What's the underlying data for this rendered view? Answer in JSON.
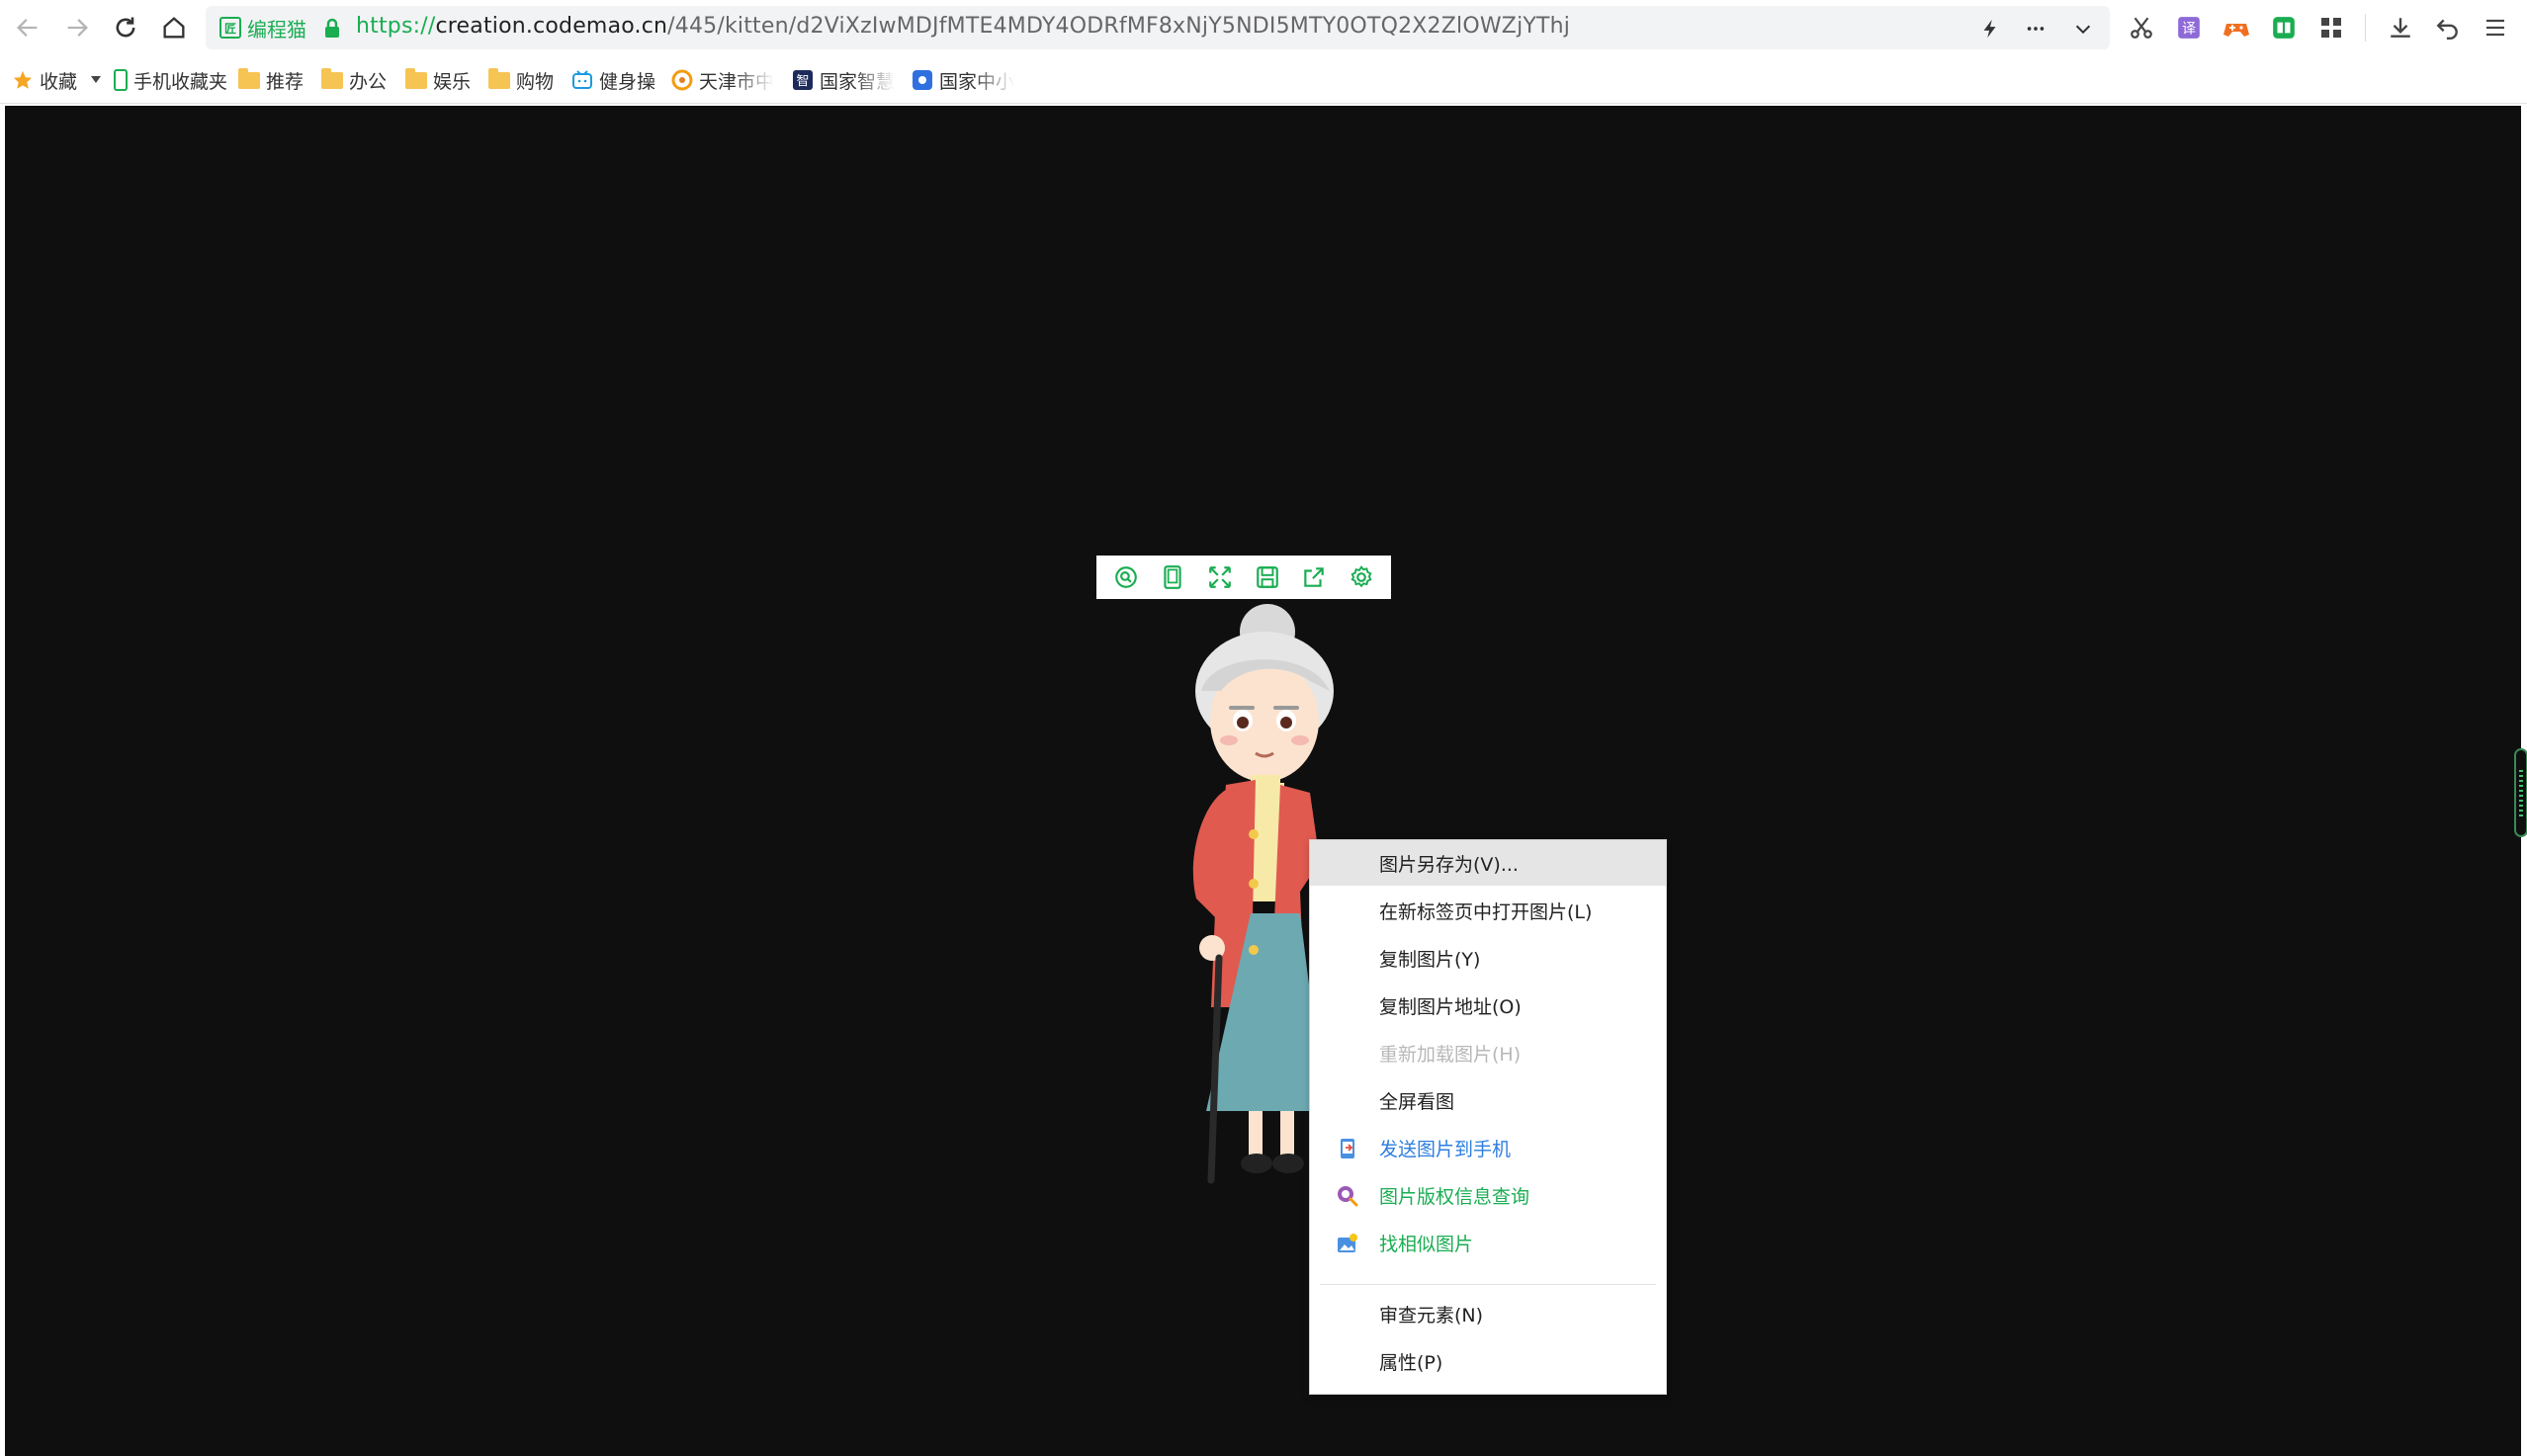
{
  "browser": {
    "site_name": "编程猫",
    "site_badge": "匠",
    "url_protocol": "https://",
    "url_host": "creation.codemao.cn",
    "url_path": "/445/kitten/d2ViXzIwMDJfMTE4MDY4ODRfMF8xNjY5NDI5MTY0OTQ2X2ZlOWZjYThj",
    "accent_color": "#1aad52"
  },
  "bookmarks": [
    {
      "label": "收藏",
      "icon": "star-icon"
    },
    {
      "label": "手机收藏夹",
      "icon": "phone-icon"
    },
    {
      "label": "推荐",
      "icon": "folder-icon"
    },
    {
      "label": "办公",
      "icon": "folder-icon"
    },
    {
      "label": "娱乐",
      "icon": "folder-icon"
    },
    {
      "label": "购物",
      "icon": "folder-icon"
    },
    {
      "label": "健身操",
      "icon": "bilibili-icon"
    },
    {
      "label": "天津市中",
      "icon": "sogou-icon"
    },
    {
      "label": "国家智慧",
      "icon": "zhi-icon"
    },
    {
      "label": "国家中小",
      "icon": "edu-icon"
    }
  ],
  "stage_toolbar": [
    "search-icon",
    "tablet-icon",
    "fullscreen-icon",
    "save-icon",
    "share-icon",
    "settings-icon"
  ],
  "context_menu": {
    "items": [
      {
        "label": "图片另存为(V)...",
        "state": "hover"
      },
      {
        "label": "在新标签页中打开图片(L)",
        "state": "normal"
      },
      {
        "label": "复制图片(Y)",
        "state": "normal"
      },
      {
        "label": "复制图片地址(O)",
        "state": "normal"
      },
      {
        "label": "重新加载图片(H)",
        "state": "disabled"
      },
      {
        "label": "全屏看图",
        "state": "normal"
      },
      {
        "label": "发送图片到手机",
        "state": "blue",
        "icon": "phone-send-icon"
      },
      {
        "label": "图片版权信息查询",
        "state": "green",
        "icon": "copyright-search-icon"
      },
      {
        "label": "找相似图片",
        "state": "green",
        "icon": "similar-image-icon"
      },
      {
        "label": "审查元素(N)",
        "state": "normal"
      },
      {
        "label": "属性(P)",
        "state": "normal"
      }
    ]
  }
}
